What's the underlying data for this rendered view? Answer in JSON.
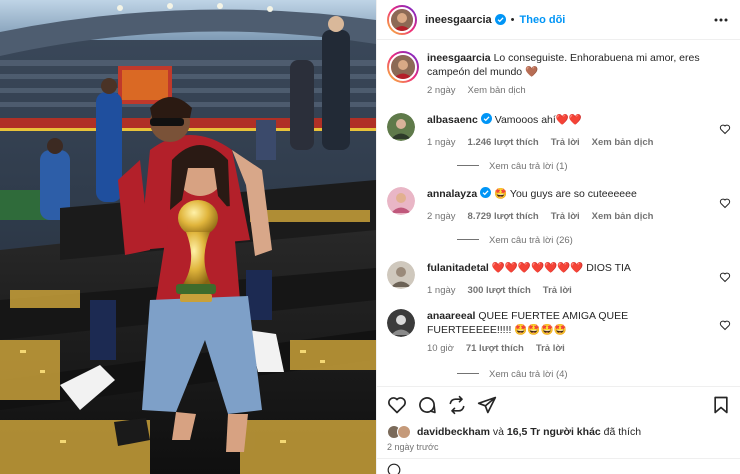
{
  "post": {
    "author": "ineesgaarcia",
    "follow_label": "Theo dõi"
  },
  "caption": {
    "author": "ineesgaarcia",
    "text": "Lo conseguiste. Enhorabuena mi amor, eres campeón del mundo 🤎",
    "time": "2 ngày",
    "translate": "Xem bản dịch"
  },
  "comments": [
    {
      "user": "albasaenc",
      "verified": true,
      "text": "Vamooos ahí❤️❤️",
      "time": "1 ngày",
      "likes": "1.246 lượt thích",
      "reply": "Trả lời",
      "translate": "Xem bản dịch",
      "view_replies": "Xem câu trả lời (1)",
      "avatar_color": "#5f7a4a"
    },
    {
      "user": "annalayza",
      "verified": true,
      "text": "🤩 You guys are so cuteeeeee",
      "time": "2 ngày",
      "likes": "8.729 lượt thích",
      "reply": "Trả lời",
      "translate": "Xem bản dịch",
      "view_replies": "Xem câu trả lời (26)",
      "avatar_color": "#d98aa6"
    },
    {
      "user": "fulanitadetal",
      "verified": false,
      "text": "❤️❤️❤️❤️❤️❤️❤️ DIOS TIA",
      "time": "1 ngày",
      "likes": "300 lượt thích",
      "reply": "Trả lời",
      "translate": "",
      "view_replies": "",
      "avatar_color": "#b9b0a4"
    },
    {
      "user": "anaareeal",
      "verified": false,
      "text": "QUEE FUERTEE AMIGA QUEE FUERTEEEEE!!!!! 🤩🤩🤩🤩",
      "time": "10 giờ",
      "likes": "71 lượt thích",
      "reply": "Trả lời",
      "translate": "",
      "view_replies": "Xem câu trả lời (4)",
      "avatar_color": "#3b3b3b"
    }
  ],
  "likes_line": {
    "first_user": "davidbeckham",
    "connector": "và",
    "others": "16,5 Tr người khác",
    "suffix": "đã thích"
  },
  "post_time": "2 ngày trước",
  "icons": {
    "like": "heart-icon",
    "comment": "comment-icon",
    "share": "share-icon",
    "send": "send-icon",
    "save": "bookmark-icon",
    "more": "more-icon",
    "verified": "verified-badge-icon"
  },
  "colors": {
    "accent": "#0095f6",
    "verified": "#0095f6",
    "meta": "#737373"
  }
}
